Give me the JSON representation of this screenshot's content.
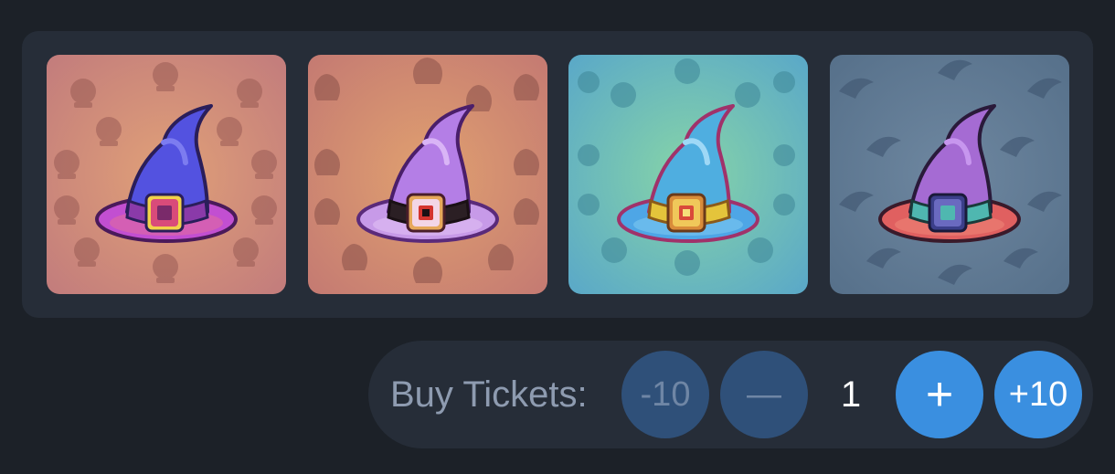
{
  "items": [
    {
      "theme": "crystal-ball",
      "bg_color": "#c98a78",
      "hat_color": "#5352e0",
      "brim_color": "#c24fd1",
      "band_color": "#8a3aa9",
      "buckle_color": "#3b6bdc",
      "pattern_color": "#9a5b55"
    },
    {
      "theme": "cauldron",
      "bg_color": "#c77f6f",
      "hat_color": "#b47ee6",
      "brim_color": "#c79ae8",
      "band_color": "#2b1f24",
      "buckle_color": "#d9944a",
      "pattern_color": "#8f554d"
    },
    {
      "theme": "eyeball",
      "bg_color": "#5fb5c9",
      "hat_color": "#4faee0",
      "brim_color": "#4ea6e6",
      "band_color": "#e4c43b",
      "buckle_color": "#d98c3a",
      "pattern_color": "#3f8797"
    },
    {
      "theme": "banana",
      "bg_color": "#5b7590",
      "hat_color": "#a56bd3",
      "brim_color": "#e06060",
      "band_color": "#4fb7b0",
      "buckle_color": "#3b3f8a",
      "pattern_color": "#3f5570"
    }
  ],
  "buy": {
    "label": "Buy Tickets:",
    "minus_ten_label": "-10",
    "minus_label": "—",
    "quantity": "1",
    "plus_label": "+",
    "plus_ten_label": "+10"
  }
}
